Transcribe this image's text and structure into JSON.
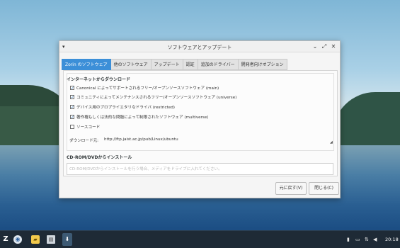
{
  "window": {
    "title": "ソフトウェアとアップデート",
    "menu_glyph": "▾",
    "controls": {
      "minimize": "⌄",
      "maximize": "⤢",
      "close": "✕"
    }
  },
  "tabs": [
    {
      "label": "Zorin のソフトウェア",
      "active": true
    },
    {
      "label": "他のソフトウェア",
      "active": false
    },
    {
      "label": "アップデート",
      "active": false
    },
    {
      "label": "認証",
      "active": false
    },
    {
      "label": "追加のドライバー",
      "active": false
    },
    {
      "label": "開発者向けオプション",
      "active": false
    }
  ],
  "internet": {
    "heading": "インターネットからダウンロード",
    "options": [
      {
        "label": "Canonical によってサポートされるフリー/オープンソースソフトウェア (main)",
        "checked": true
      },
      {
        "label": "コミュニティによってメンテナンスされるフリー/オープンソースソフトウェア (universe)",
        "checked": true
      },
      {
        "label": "デバイス用のプロプライエタリなドライバ (restricted)",
        "checked": true
      },
      {
        "label": "著作権もしくは法的な問題によって制限されたソフトウェア (multiverse)",
        "checked": true
      },
      {
        "label": "ソースコード",
        "checked": false
      }
    ],
    "download_label": "ダウンロード元:",
    "download_value": "http://ftp.jaist.ac.jp/pub/Linux/ubuntu"
  },
  "cdrom": {
    "heading": "CD-ROM/DVDからインストール",
    "placeholder": "CD-ROM/DVDからインストールを行う場合、メディアをドライブに入れてください。"
  },
  "buttons": {
    "revert": "元に戻す(V)",
    "close": "閉じる(C)"
  },
  "taskbar": {
    "start_glyph": "Z",
    "browser_glyph": "◉",
    "files_glyph": "▰",
    "terminal_glyph": "▤",
    "app_glyph": "⬇",
    "battery_glyph": "▮",
    "keyboard_glyph": "▭",
    "network_glyph": "⇅",
    "volume_glyph": "◀",
    "clock": "20:18"
  },
  "colors": {
    "accent": "#3c8fd8",
    "taskbar": "#1e2a36"
  }
}
